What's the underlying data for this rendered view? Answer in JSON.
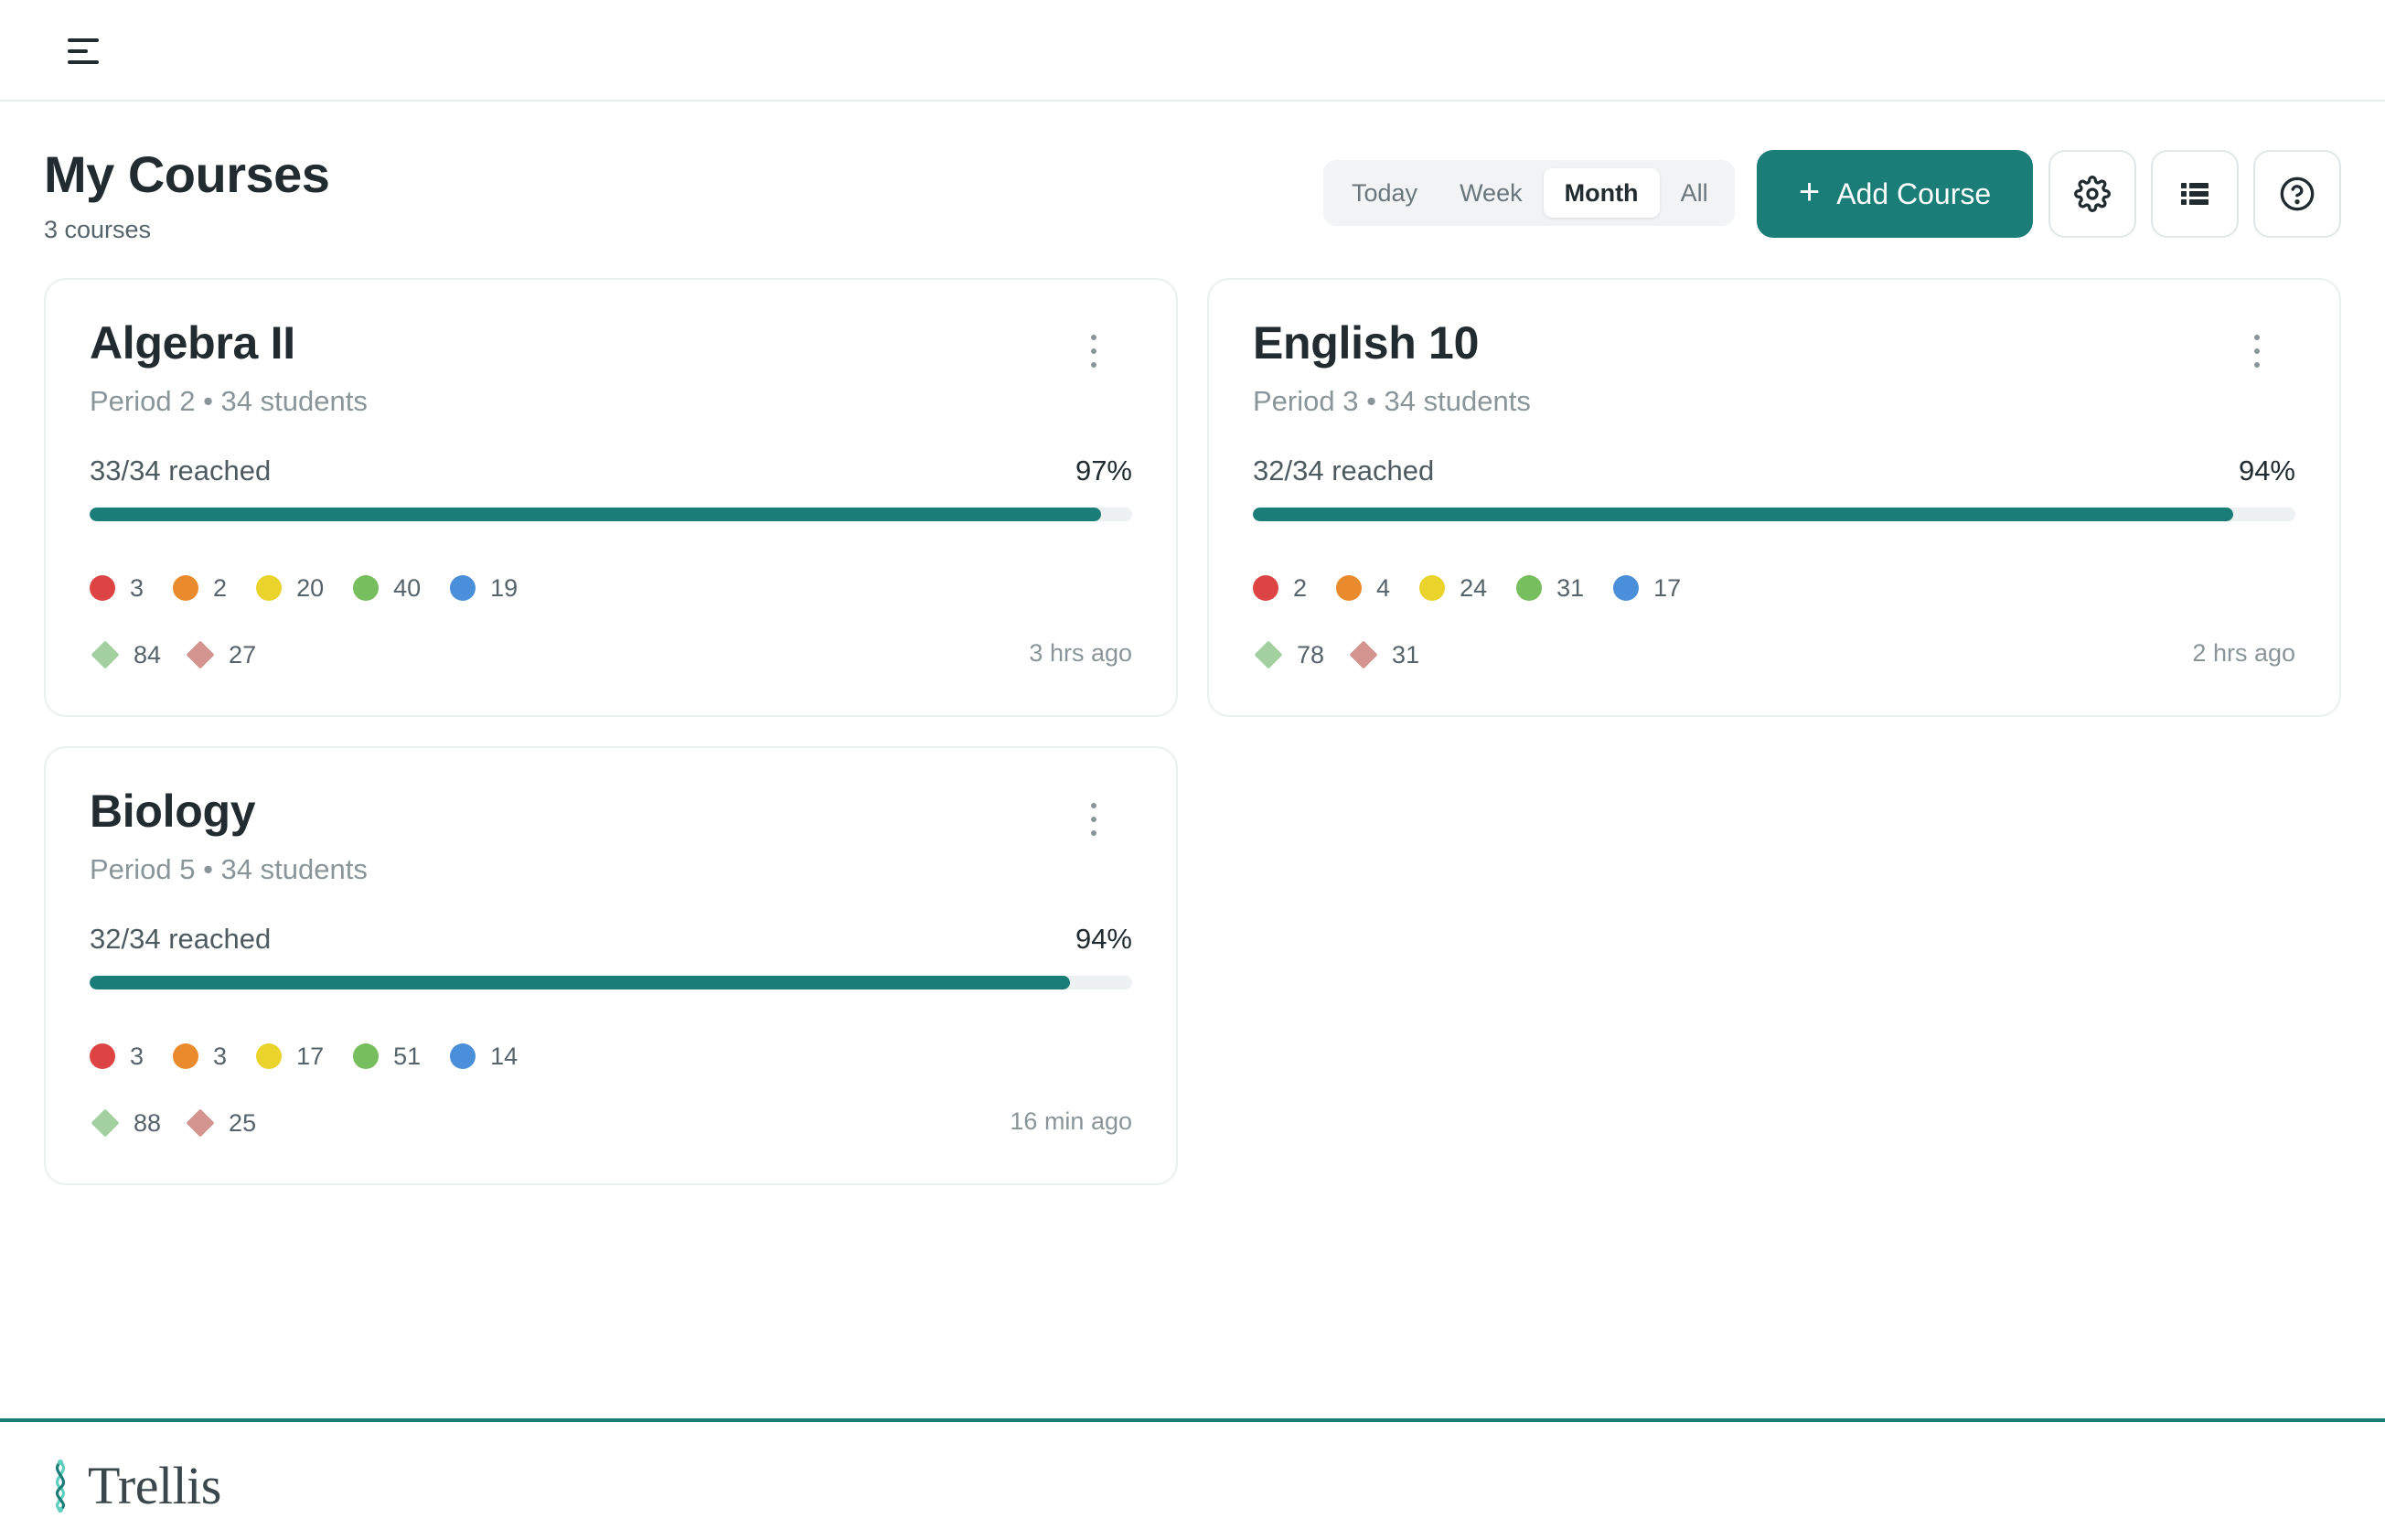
{
  "header": {
    "menu_icon": "hamburger-menu-icon"
  },
  "page": {
    "title": "My Courses",
    "subtitle": "3 courses"
  },
  "toolbar": {
    "ranges": [
      "Today",
      "Week",
      "Month",
      "All"
    ],
    "active_range": "Month",
    "add_course_label": "Add Course",
    "settings_icon": "gear-icon",
    "list_view_icon": "list-view-icon",
    "help_icon": "help-circle-icon"
  },
  "courses": [
    {
      "title": "Algebra II",
      "meta": "Period 2 • 34 students",
      "reached_text": "33/34 reached",
      "percent_text": "97%",
      "progress": 0.97,
      "dots": [
        "3",
        "2",
        "20",
        "40",
        "19"
      ],
      "diamonds": [
        "84",
        "27"
      ],
      "updated": "3 hrs ago"
    },
    {
      "title": "English 10",
      "meta": "Period 3 • 34 students",
      "reached_text": "32/34 reached",
      "percent_text": "94%",
      "progress": 0.94,
      "dots": [
        "2",
        "4",
        "24",
        "31",
        "17"
      ],
      "diamonds": [
        "78",
        "31"
      ],
      "updated": "2 hrs ago"
    },
    {
      "title": "Biology",
      "meta": "Period 5 • 34 students",
      "reached_text": "32/34 reached",
      "percent_text": "94%",
      "progress": 0.94,
      "dots": [
        "3",
        "3",
        "17",
        "51",
        "14"
      ],
      "diamonds": [
        "88",
        "25"
      ],
      "updated": "16 min ago"
    }
  ],
  "status_colors": {
    "dots": [
      "#dd4343",
      "#e98a2c",
      "#ead32a",
      "#76be5e",
      "#4a8fd9"
    ],
    "diamonds": [
      "#a3d0a0",
      "#d49590"
    ],
    "accent": "#1b7d78"
  },
  "footer": {
    "brand": "Trellis",
    "logo_icon": "trellis-logo-icon"
  }
}
